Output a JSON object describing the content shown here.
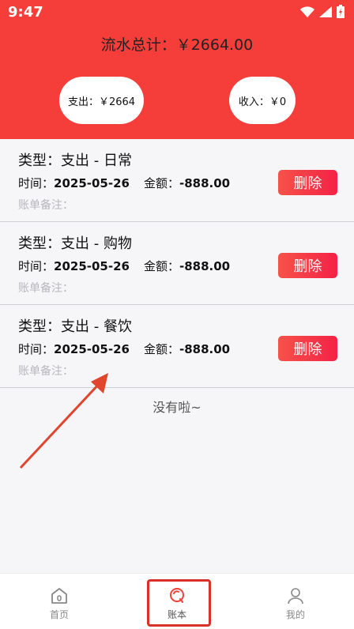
{
  "status": {
    "time": "9:47"
  },
  "header": {
    "total_label": "流水总计：￥2664.00",
    "expense_label": "支出：￥2664",
    "income_label": "收入：￥0"
  },
  "records": [
    {
      "type": "类型：支出 - 日常",
      "time_label": "时间：",
      "date": "2025-05-26",
      "amount_label": "金额：",
      "amount": "-888.00",
      "note_label": "账单备注：",
      "delete_label": "删除"
    },
    {
      "type": "类型：支出 - 购物",
      "time_label": "时间：",
      "date": "2025-05-26",
      "amount_label": "金额：",
      "amount": "-888.00",
      "note_label": "账单备注：",
      "delete_label": "删除"
    },
    {
      "type": "类型：支出 - 餐饮",
      "time_label": "时间：",
      "date": "2025-05-26",
      "amount_label": "金额：",
      "amount": "-888.00",
      "note_label": "账单备注：",
      "delete_label": "删除"
    }
  ],
  "end_text": "没有啦~",
  "tabbar": [
    {
      "label": "首页",
      "icon": "home-icon"
    },
    {
      "label": "账本",
      "icon": "ledger-icon",
      "active": true
    },
    {
      "label": "我的",
      "icon": "user-icon"
    }
  ],
  "colors": {
    "brand": "#f53e3a",
    "delete_button": "#f42245",
    "annotation": "#d9302a"
  }
}
